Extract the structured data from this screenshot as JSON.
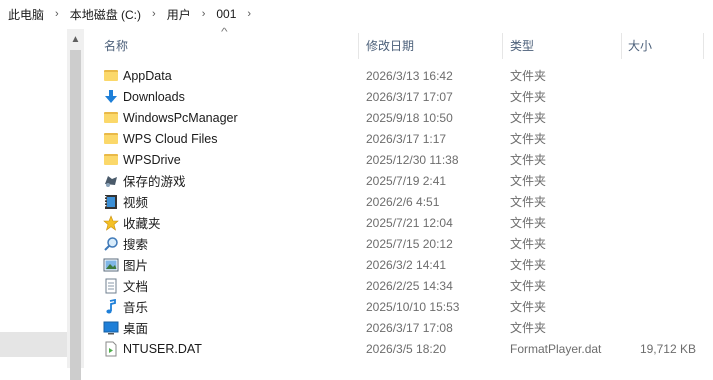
{
  "breadcrumb": [
    "此电脑",
    "本地磁盘 (C:)",
    "用户",
    "001"
  ],
  "header": {
    "name": "名称",
    "date": "修改日期",
    "type": "类型",
    "size": "大小"
  },
  "files": [
    {
      "icon": "folder-icon",
      "name": "AppData",
      "date": "2026/3/13 16:42",
      "type": "文件夹",
      "size": ""
    },
    {
      "icon": "download-icon",
      "name": "Downloads",
      "date": "2026/3/17 17:07",
      "type": "文件夹",
      "size": ""
    },
    {
      "icon": "folder-icon",
      "name": "WindowsPcManager",
      "date": "2025/9/18 10:50",
      "type": "文件夹",
      "size": ""
    },
    {
      "icon": "folder-icon",
      "name": "WPS Cloud Files",
      "date": "2026/3/17 1:17",
      "type": "文件夹",
      "size": ""
    },
    {
      "icon": "folder-icon",
      "name": "WPSDrive",
      "date": "2025/12/30 11:38",
      "type": "文件夹",
      "size": ""
    },
    {
      "icon": "saved-games-icon",
      "name": "保存的游戏",
      "date": "2025/7/19 2:41",
      "type": "文件夹",
      "size": ""
    },
    {
      "icon": "videos-icon",
      "name": "视频",
      "date": "2026/2/6 4:51",
      "type": "文件夹",
      "size": ""
    },
    {
      "icon": "favorites-icon",
      "name": "收藏夹",
      "date": "2025/7/21 12:04",
      "type": "文件夹",
      "size": ""
    },
    {
      "icon": "search-icon",
      "name": "搜索",
      "date": "2025/7/15 20:12",
      "type": "文件夹",
      "size": ""
    },
    {
      "icon": "pictures-icon",
      "name": "图片",
      "date": "2026/3/2 14:41",
      "type": "文件夹",
      "size": ""
    },
    {
      "icon": "documents-icon",
      "name": "文档",
      "date": "2026/2/25 14:34",
      "type": "文件夹",
      "size": ""
    },
    {
      "icon": "music-icon",
      "name": "音乐",
      "date": "2025/10/10 15:53",
      "type": "文件夹",
      "size": ""
    },
    {
      "icon": "desktop-icon",
      "name": "桌面",
      "date": "2026/3/17 17:08",
      "type": "文件夹",
      "size": ""
    },
    {
      "icon": "file-icon",
      "name": "NTUSER.DAT",
      "date": "2026/3/5 18:20",
      "type": "FormatPlayer.dat",
      "size": "19,712 KB"
    }
  ],
  "colors": {
    "folder": "#fbd86a",
    "header_text": "#4c607a",
    "accent": "#1e7fd8"
  }
}
